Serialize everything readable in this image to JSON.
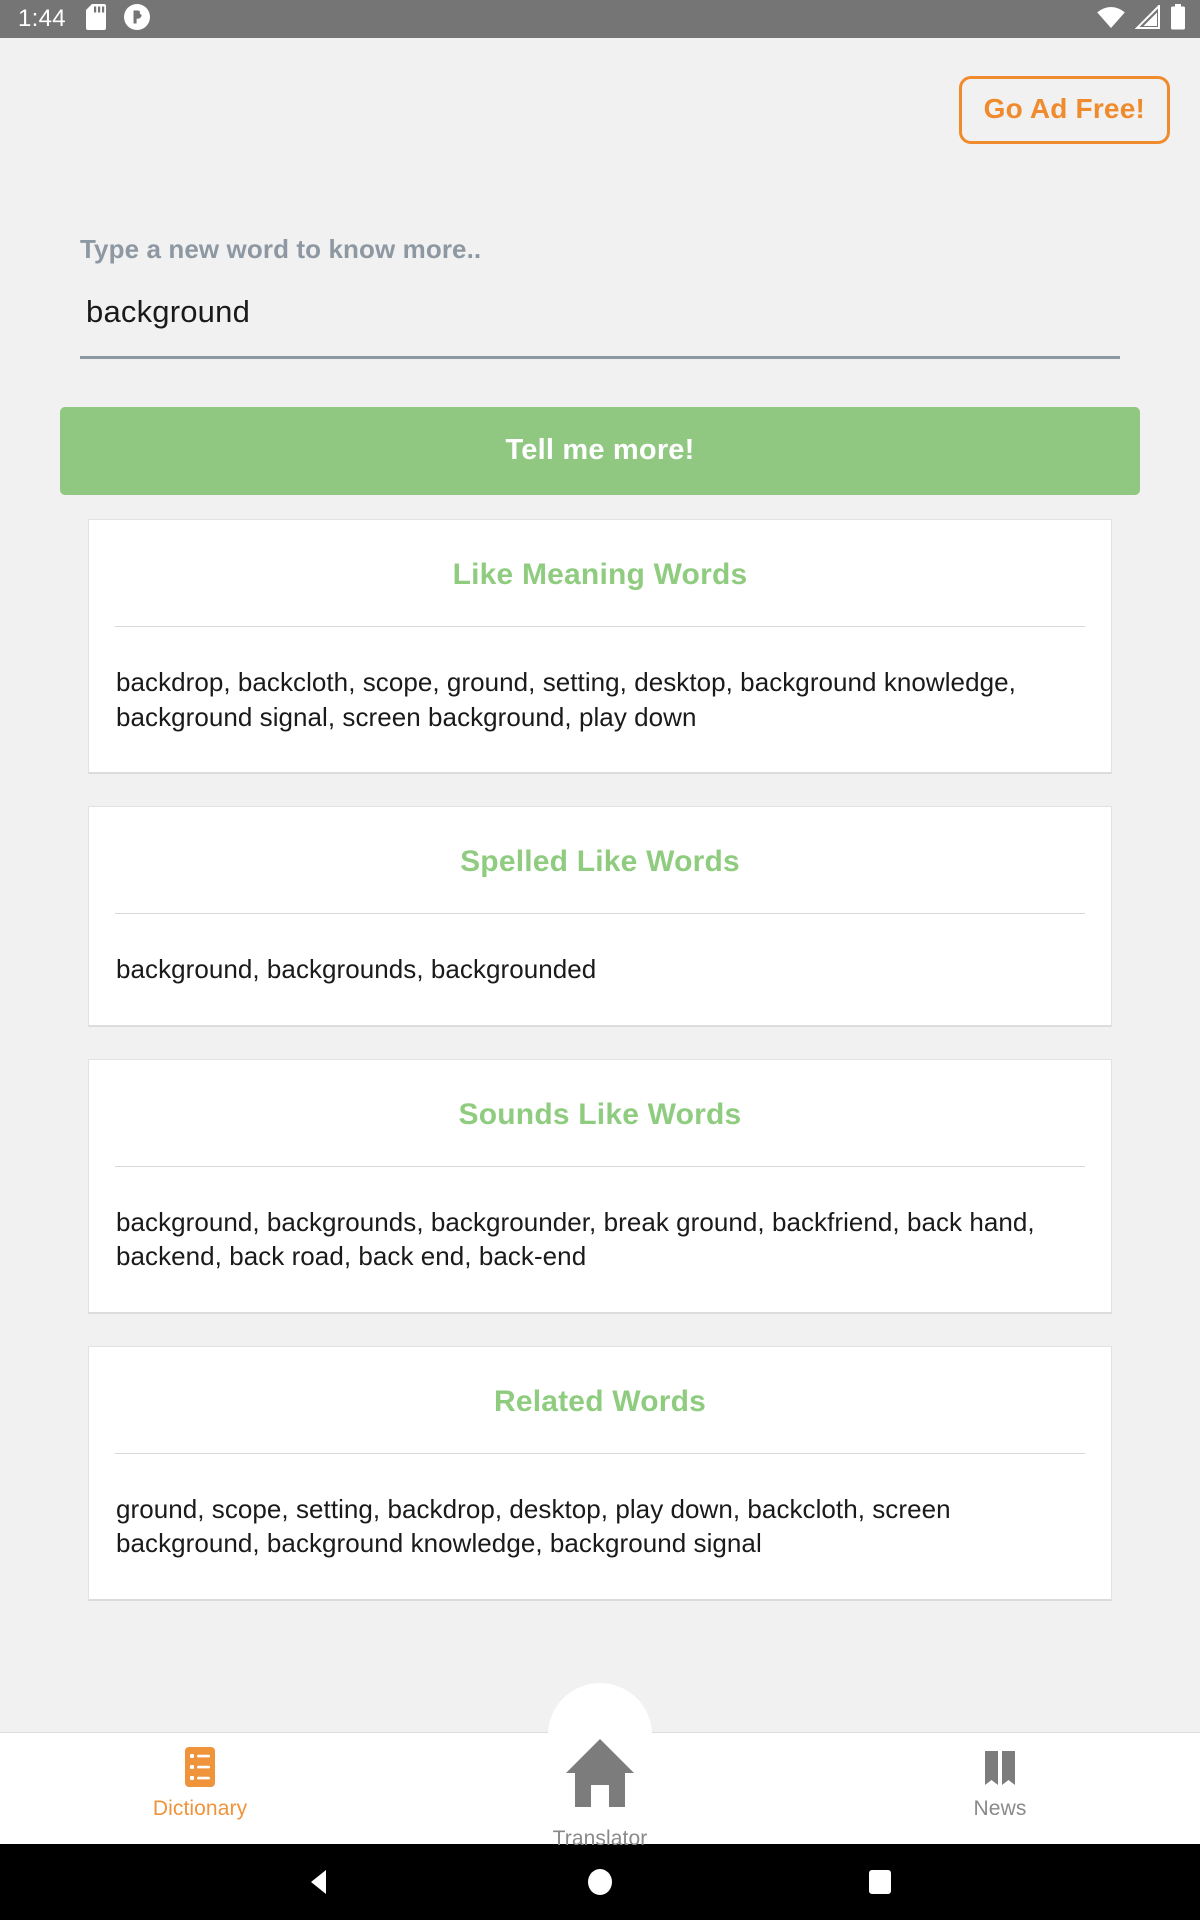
{
  "status_bar": {
    "clock": "1:44",
    "left_icons": [
      "sd-card-icon",
      "app-notification-icon"
    ],
    "right_icons": [
      "wifi-icon",
      "cellular-signal-icon",
      "battery-icon"
    ],
    "background_color": "#757575"
  },
  "header": {
    "ad_free_label": "Go Ad Free!",
    "ad_free_color": "#ef8b2c"
  },
  "search": {
    "label": "Type a new word to know more..",
    "value": "background",
    "placeholder": "Type a new word to know more..",
    "submit_label": "Tell me more!",
    "submit_color": "#90c882"
  },
  "cards": [
    {
      "title": "Like Meaning Words",
      "body": "backdrop, backcloth, scope, ground, setting, desktop, background knowledge, background signal, screen background, play down"
    },
    {
      "title": "Spelled Like Words",
      "body": "background, backgrounds, backgrounded"
    },
    {
      "title": "Sounds Like Words",
      "body": "background, backgrounds, backgrounder, break ground, backfriend, back hand, backend, back road, back end, back-end"
    },
    {
      "title": "Related Words",
      "body": "ground, scope, setting, backdrop, desktop, play down, backcloth, screen background, background knowledge, background signal"
    }
  ],
  "card_title_color": "#8fcc80",
  "bottom_nav": {
    "items": [
      {
        "label": "Dictionary",
        "icon": "list-icon",
        "active": true
      },
      {
        "label": "Translator",
        "icon": "home-icon",
        "active": false
      },
      {
        "label": "News",
        "icon": "book-icon",
        "active": false
      }
    ],
    "active_color": "#f0943c",
    "inactive_color": "#8a8a8a"
  },
  "android_nav": {
    "buttons": [
      "back-triangle-icon",
      "home-circle-icon",
      "recents-square-icon"
    ]
  }
}
